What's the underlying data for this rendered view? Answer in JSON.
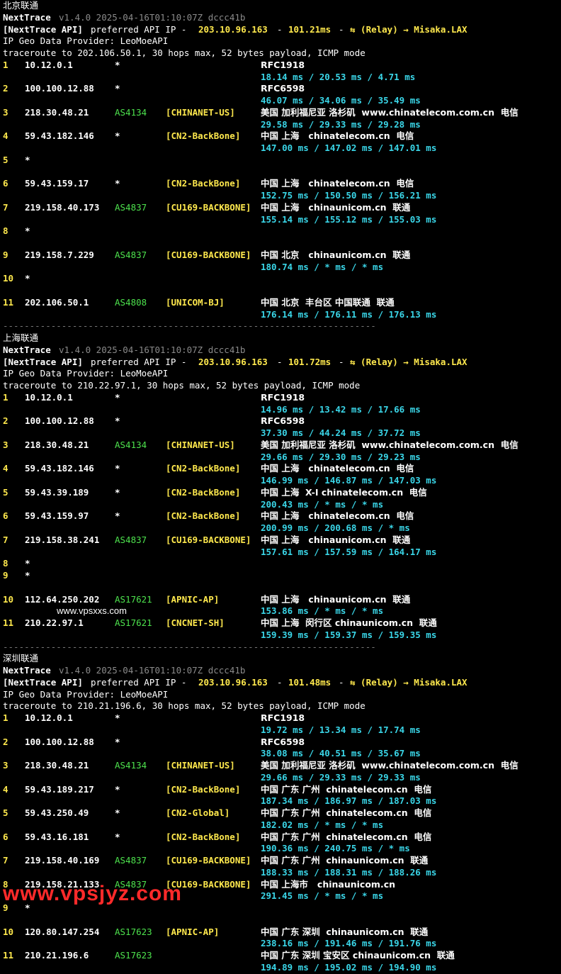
{
  "watermark_text": "www.vpsxxs.com",
  "watermark_bottom": "www.vpsjyz.com",
  "separator": "----------------------------------------------------------------------",
  "sections": [
    {
      "title": "北京联通",
      "app": "NextTrace",
      "version": "v1.4.0 2025-04-16T01:10:07Z dccc41b",
      "api_label": "[NextTrace API]",
      "api_text": "preferred API IP -",
      "api_ip": "203.10.96.163",
      "api_dash1": "-",
      "api_latency": "101.21ms",
      "api_dash2": "-",
      "api_relay": "⇆ (Relay) → Misaka.LAX",
      "geo_provider": "IP Geo Data Provider: LeoMoeAPI",
      "traceroute": "traceroute to 202.106.50.1, 30 hops max, 52 bytes payload, ICMP mode",
      "hops": [
        {
          "n": "1",
          "ip": "10.12.0.1",
          "as": "*",
          "tag": "",
          "geo": "RFC1918",
          "rtt": "18.14 ms / 20.53 ms / 4.71 ms"
        },
        {
          "n": "2",
          "ip": "100.100.12.88",
          "as": "*",
          "tag": "",
          "geo": "RFC6598",
          "rtt": "46.07 ms / 34.06 ms / 35.49 ms"
        },
        {
          "n": "3",
          "ip": "218.30.48.21",
          "as": "AS4134",
          "tag": "[CHINANET-US]",
          "geo": "美国 加利福尼亚 洛杉矶  www.chinatelecom.com.cn  电信",
          "rtt": "29.58 ms / 29.33 ms / 29.28 ms"
        },
        {
          "n": "4",
          "ip": "59.43.182.146",
          "as": "*",
          "tag": "[CN2-BackBone]",
          "geo": "中国 上海   chinatelecom.cn  电信",
          "rtt": "147.00 ms / 147.02 ms / 147.01 ms"
        },
        {
          "n": "5",
          "ip": "*",
          "as": "",
          "tag": "",
          "geo": "",
          "rtt": ""
        },
        {
          "n": "6",
          "ip": "59.43.159.17",
          "as": "*",
          "tag": "[CN2-BackBone]",
          "geo": "中国 上海   chinatelecom.cn  电信",
          "rtt": "152.75 ms / 150.50 ms / 156.21 ms"
        },
        {
          "n": "7",
          "ip": "219.158.40.173",
          "as": "AS4837",
          "tag": "[CU169-BACKBONE]",
          "geo": "中国 上海   chinaunicom.cn  联通",
          "rtt": "155.14 ms / 155.12 ms / 155.03 ms"
        },
        {
          "n": "8",
          "ip": "*",
          "as": "",
          "tag": "",
          "geo": "",
          "rtt": ""
        },
        {
          "n": "9",
          "ip": "219.158.7.229",
          "as": "AS4837",
          "tag": "[CU169-BACKBONE]",
          "geo": "中国 北京   chinaunicom.cn  联通",
          "rtt": "180.74 ms / * ms / * ms"
        },
        {
          "n": "10",
          "ip": "*",
          "as": "",
          "tag": "",
          "geo": "",
          "rtt": ""
        },
        {
          "n": "11",
          "ip": "202.106.50.1",
          "as": "AS4808",
          "tag": "[UNICOM-BJ]",
          "geo": "中国 北京  丰台区 中国联通  联通",
          "rtt": "176.14 ms / 176.11 ms / 176.13 ms"
        }
      ]
    },
    {
      "title": "上海联通",
      "app": "NextTrace",
      "version": "v1.4.0 2025-04-16T01:10:07Z dccc41b",
      "api_label": "[NextTrace API]",
      "api_text": "preferred API IP -",
      "api_ip": "203.10.96.163",
      "api_dash1": "-",
      "api_latency": "101.72ms",
      "api_dash2": "-",
      "api_relay": "⇆ (Relay) → Misaka.LAX",
      "geo_provider": "IP Geo Data Provider: LeoMoeAPI",
      "traceroute": "traceroute to 210.22.97.1, 30 hops max, 52 bytes payload, ICMP mode",
      "hops": [
        {
          "n": "1",
          "ip": "10.12.0.1",
          "as": "*",
          "tag": "",
          "geo": "RFC1918",
          "rtt": "14.96 ms / 13.42 ms / 17.66 ms"
        },
        {
          "n": "2",
          "ip": "100.100.12.88",
          "as": "*",
          "tag": "",
          "geo": "RFC6598",
          "rtt": "37.30 ms / 44.24 ms / 37.72 ms"
        },
        {
          "n": "3",
          "ip": "218.30.48.21",
          "as": "AS4134",
          "tag": "[CHINANET-US]",
          "geo": "美国 加利福尼亚 洛杉矶  www.chinatelecom.com.cn  电信",
          "rtt": "29.66 ms / 29.30 ms / 29.23 ms"
        },
        {
          "n": "4",
          "ip": "59.43.182.146",
          "as": "*",
          "tag": "[CN2-BackBone]",
          "geo": "中国 上海   chinatelecom.cn  电信",
          "rtt": "146.99 ms / 146.87 ms / 147.03 ms"
        },
        {
          "n": "5",
          "ip": "59.43.39.189",
          "as": "*",
          "tag": "[CN2-BackBone]",
          "geo": "中国 上海  X-I chinatelecom.cn  电信",
          "rtt": "200.43 ms / * ms / * ms"
        },
        {
          "n": "6",
          "ip": "59.43.159.97",
          "as": "*",
          "tag": "[CN2-BackBone]",
          "geo": "中国 上海   chinatelecom.cn  电信",
          "rtt": "200.99 ms / 200.68 ms / * ms"
        },
        {
          "n": "7",
          "ip": "219.158.38.241",
          "as": "AS4837",
          "tag": "[CU169-BACKBONE]",
          "geo": "中国 上海   chinaunicom.cn  联通",
          "rtt": "157.61 ms / 157.59 ms / 164.17 ms"
        },
        {
          "n": "8",
          "ip": "*",
          "as": "",
          "tag": "",
          "geo": "",
          "rtt": "",
          "single": true
        },
        {
          "n": "9",
          "ip": "*",
          "as": "",
          "tag": "",
          "geo": "",
          "rtt": ""
        },
        {
          "n": "10",
          "ip": "112.64.250.202",
          "as": "AS17621",
          "tag": "[APNIC-AP]",
          "geo": "中国 上海   chinaunicom.cn  联通",
          "rtt": "153.86 ms / * ms / * ms"
        },
        {
          "n": "11",
          "ip": "210.22.97.1",
          "as": "AS17621",
          "tag": "[CNCNET-SH]",
          "geo": "中国 上海  闵行区 chinaunicom.cn  联通",
          "rtt": "159.39 ms / 159.37 ms / 159.35 ms"
        }
      ]
    },
    {
      "title": "深圳联通",
      "app": "NextTrace",
      "version": "v1.4.0 2025-04-16T01:10:07Z dccc41b",
      "api_label": "[NextTrace API]",
      "api_text": "preferred API IP -",
      "api_ip": "203.10.96.163",
      "api_dash1": "-",
      "api_latency": "101.48ms",
      "api_dash2": "-",
      "api_relay": "⇆ (Relay) → Misaka.LAX",
      "geo_provider": "IP Geo Data Provider: LeoMoeAPI",
      "traceroute": "traceroute to 210.21.196.6, 30 hops max, 52 bytes payload, ICMP mode",
      "hops": [
        {
          "n": "1",
          "ip": "10.12.0.1",
          "as": "*",
          "tag": "",
          "geo": "RFC1918",
          "rtt": "19.72 ms / 13.34 ms / 17.74 ms"
        },
        {
          "n": "2",
          "ip": "100.100.12.88",
          "as": "*",
          "tag": "",
          "geo": "RFC6598",
          "rtt": "38.08 ms / 40.51 ms / 35.67 ms"
        },
        {
          "n": "3",
          "ip": "218.30.48.21",
          "as": "AS4134",
          "tag": "[CHINANET-US]",
          "geo": "美国 加利福尼亚 洛杉矶  www.chinatelecom.com.cn  电信",
          "rtt": "29.66 ms / 29.33 ms / 29.33 ms"
        },
        {
          "n": "4",
          "ip": "59.43.189.217",
          "as": "*",
          "tag": "[CN2-BackBone]",
          "geo": "中国 广东 广州  chinatelecom.cn  电信",
          "rtt": "187.34 ms / 186.97 ms / 187.03 ms"
        },
        {
          "n": "5",
          "ip": "59.43.250.49",
          "as": "*",
          "tag": "[CN2-Global]",
          "geo": "中国 广东 广州  chinatelecom.cn  电信",
          "rtt": "182.02 ms / * ms / * ms"
        },
        {
          "n": "6",
          "ip": "59.43.16.181",
          "as": "*",
          "tag": "[CN2-BackBone]",
          "geo": "中国 广东 广州  chinatelecom.cn  电信",
          "rtt": "190.36 ms / 240.75 ms / * ms"
        },
        {
          "n": "7",
          "ip": "219.158.40.169",
          "as": "AS4837",
          "tag": "[CU169-BACKBONE]",
          "geo": "中国 广东 广州  chinaunicom.cn  联通",
          "rtt": "188.33 ms / 188.31 ms / 188.26 ms"
        },
        {
          "n": "8",
          "ip": "219.158.21.133",
          "as": "AS4837",
          "tag": "[CU169-BACKBONE]",
          "geo": "中国 上海市   chinaunicom.cn",
          "rtt": "291.45 ms / * ms / * ms"
        },
        {
          "n": "9",
          "ip": "*",
          "as": "",
          "tag": "",
          "geo": "",
          "rtt": ""
        },
        {
          "n": "10",
          "ip": "120.80.147.254",
          "as": "AS17623",
          "tag": "[APNIC-AP]",
          "geo": "中国 广东 深圳  chinaunicom.cn  联通",
          "rtt": "238.16 ms / 191.46 ms / 191.76 ms"
        },
        {
          "n": "11",
          "ip": "210.21.196.6",
          "as": "AS17623",
          "tag": "",
          "geo": "中国 广东 深圳 宝安区 chinaunicom.cn  联通",
          "rtt": "194.89 ms / 195.02 ms / 194.90 ms"
        }
      ]
    }
  ]
}
